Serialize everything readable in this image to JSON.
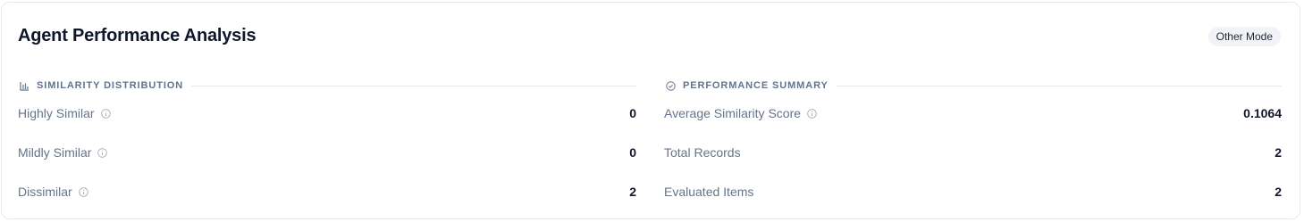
{
  "card": {
    "title": "Agent Performance Analysis",
    "mode_badge": "Other Mode"
  },
  "similarity": {
    "title": "SIMILARITY DISTRIBUTION",
    "icon": "bar-chart-icon",
    "rows": [
      {
        "label": "Highly Similar",
        "value": "0",
        "info": true
      },
      {
        "label": "Mildly Similar",
        "value": "0",
        "info": true
      },
      {
        "label": "Dissimilar",
        "value": "2",
        "info": true
      }
    ]
  },
  "performance": {
    "title": "PERFORMANCE SUMMARY",
    "icon": "check-circle-icon",
    "rows": [
      {
        "label": "Average Similarity Score",
        "value": "0.1064",
        "info": true
      },
      {
        "label": "Total Records",
        "value": "2",
        "info": false
      },
      {
        "label": "Evaluated Items",
        "value": "2",
        "info": false
      }
    ]
  },
  "colors": {
    "title": "#0f172a",
    "muted": "#64748b",
    "border": "#e6e8ec",
    "badge_bg": "#f1f3f6"
  }
}
